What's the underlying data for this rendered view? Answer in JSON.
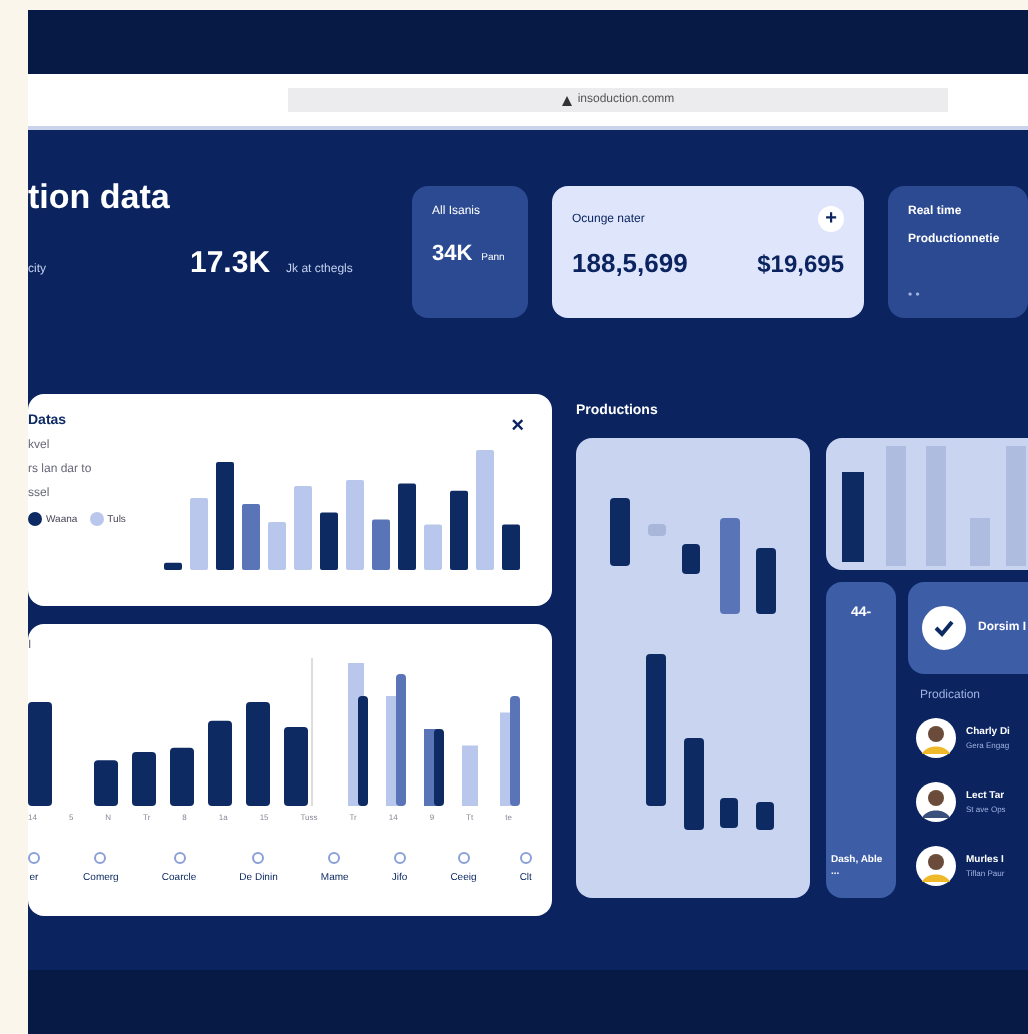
{
  "browser": {
    "url": "insoduction.comm"
  },
  "header": {
    "title": "tion data",
    "stat_label": "city",
    "stat_value": "17.3K",
    "stat_note": "Jk at cthegls"
  },
  "cards": [
    {
      "kind": "small",
      "title": "All Isanis",
      "value": "34K",
      "unit": "Pann"
    },
    {
      "kind": "wide",
      "title": "Ocunge nater",
      "action": "+",
      "value": "188,5,699",
      "value_2": "$19,695"
    },
    {
      "kind": "cut",
      "title": "Real time",
      "subtitle": "Productionnetie",
      "dots": "• •"
    }
  ],
  "datas_panel": {
    "title": "Datas",
    "close": "×",
    "lines": [
      "kvel",
      "rs lan dar to",
      "ssel"
    ],
    "legend": [
      {
        "label": "Waana",
        "color": "#0d2a63"
      },
      {
        "label": "Tuls",
        "color": "#b9c7ec"
      }
    ]
  },
  "bottom_panel": {
    "corner": "I",
    "tick_labels": [
      "14",
      "5",
      "N",
      "Tr",
      "8",
      "1a",
      "15",
      "Tuss",
      "Tr",
      "14",
      "9",
      "Tt",
      "te"
    ],
    "categories": [
      "er",
      "Comerg",
      "Coarcle",
      "De Dinin",
      "Mame",
      "Jifo",
      "Ceeig",
      "Clt"
    ]
  },
  "productions": {
    "title": "Productions"
  },
  "side_column": {
    "top": "44-",
    "bottom": "Dash, Able ..."
  },
  "check_card": {
    "label": "Dorsim I",
    "checked": true
  },
  "people": {
    "title": "Prodication",
    "items": [
      {
        "name": "Charly Di",
        "note": "Gera Engag"
      },
      {
        "name": "Lect Tar",
        "note": "St ave Ops"
      },
      {
        "name": "Murles I",
        "note": "Tiflan Paur"
      }
    ]
  }
}
